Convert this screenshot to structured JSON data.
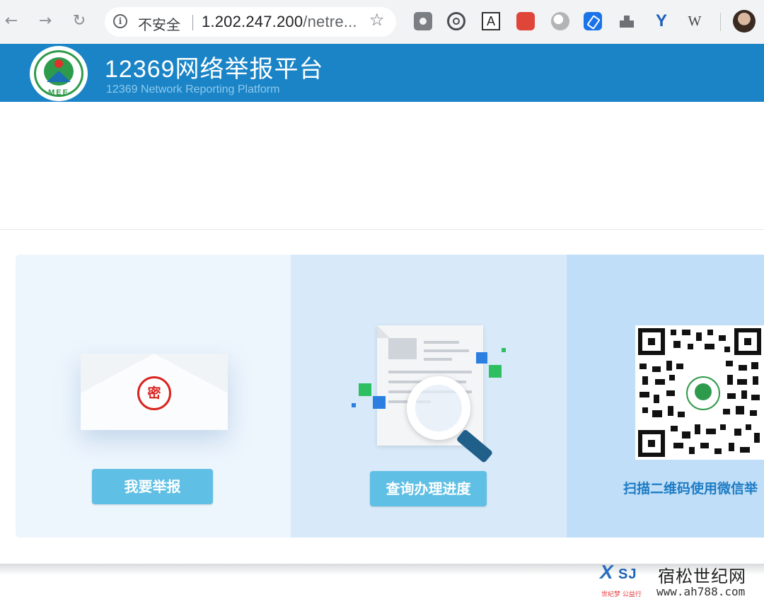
{
  "browser": {
    "security_label": "不安全",
    "url_main": "1.202.247.200",
    "url_rest": "/netre...",
    "icons": [
      "back-icon",
      "forward-icon",
      "reload-icon",
      "info-icon",
      "star-icon",
      "camera-icon",
      "spiral-icon",
      "translate-icon",
      "red-extension-icon",
      "grey-circle-icon",
      "blue-pen-icon",
      "tray-icon",
      "y-extension-icon",
      "w-extension-icon",
      "avatar"
    ]
  },
  "header": {
    "logo_text": "MEE",
    "title": "12369网络举报平台",
    "subtitle": "12369 Network Reporting Platform",
    "color": "#1a84c7"
  },
  "cards": {
    "report": {
      "seal_char": "密",
      "button_label": "我要举报"
    },
    "query": {
      "button_label": "查询办理进度"
    },
    "wechat": {
      "text": "扫描二维码使用微信举"
    }
  },
  "watermark": {
    "logo_letters": "X",
    "logo_letters_2": "SJ",
    "small_text": "世纪梦 公益行",
    "title": "宿松世纪网",
    "url": "www.ah788.com"
  },
  "colors": {
    "accent": "#5fbfe4",
    "card_report_bg": "#edf5fd",
    "card_query_bg": "#d8eaf9",
    "card_wechat_bg": "#c1def8",
    "seal_red": "#d9231f"
  }
}
